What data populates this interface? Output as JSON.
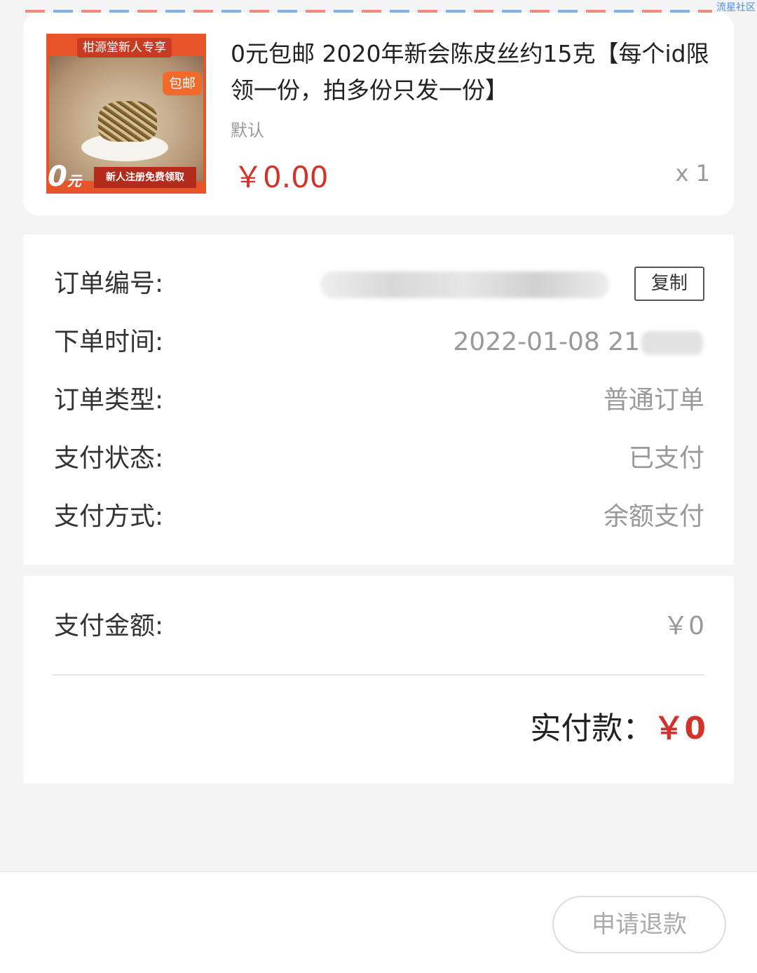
{
  "watermark": "流星社区",
  "product": {
    "image": {
      "banner_text": "柑源堂新人专享",
      "badge_text": "包邮",
      "zero_text": "0",
      "zero_unit": "元",
      "strip_text": "新人注册免费领取"
    },
    "title": "0元包邮 2020年新会陈皮丝约15克【每个id限领一份，拍多份只发一份】",
    "spec": "默认",
    "price": "￥0.00",
    "quantity": "x 1"
  },
  "order_info": {
    "order_number_label": "订单编号:",
    "copy_button": "复制",
    "order_time_label": "下单时间:",
    "order_time_value": "2022-01-08 21",
    "order_type_label": "订单类型:",
    "order_type_value": "普通订单",
    "payment_status_label": "支付状态:",
    "payment_status_value": "已支付",
    "payment_method_label": "支付方式:",
    "payment_method_value": "余额支付"
  },
  "amount": {
    "paid_amount_label": "支付金额:",
    "paid_amount_value": "￥0",
    "actual_label": "实付款：",
    "actual_value": "￥0"
  },
  "footer": {
    "refund_button": "申请退款"
  },
  "colors": {
    "accent_red": "#d0342c",
    "muted_text": "#999999",
    "background": "#f4f4f4"
  }
}
